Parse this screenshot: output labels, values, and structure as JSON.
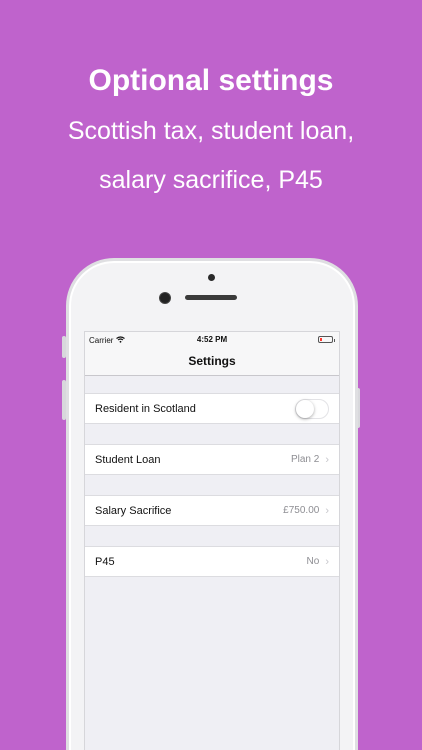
{
  "promo": {
    "headline": "Optional settings",
    "subtitle_line1": "Scottish tax, student loan,",
    "subtitle_line2": "salary sacrifice, P45"
  },
  "status_bar": {
    "carrier": "Carrier",
    "time": "4:52 PM",
    "wifi_icon": "wifi-icon",
    "battery_icon": "battery-low-icon"
  },
  "nav": {
    "title": "Settings"
  },
  "settings": {
    "resident_scotland": {
      "label": "Resident in Scotland",
      "toggle_on": false
    },
    "student_loan": {
      "label": "Student Loan",
      "value": "Plan 2"
    },
    "salary_sacrifice": {
      "label": "Salary Sacrifice",
      "value": "£750.00"
    },
    "p45": {
      "label": "P45",
      "value": "No"
    }
  },
  "colors": {
    "background": "#bf63cc",
    "text": "#ffffff"
  }
}
